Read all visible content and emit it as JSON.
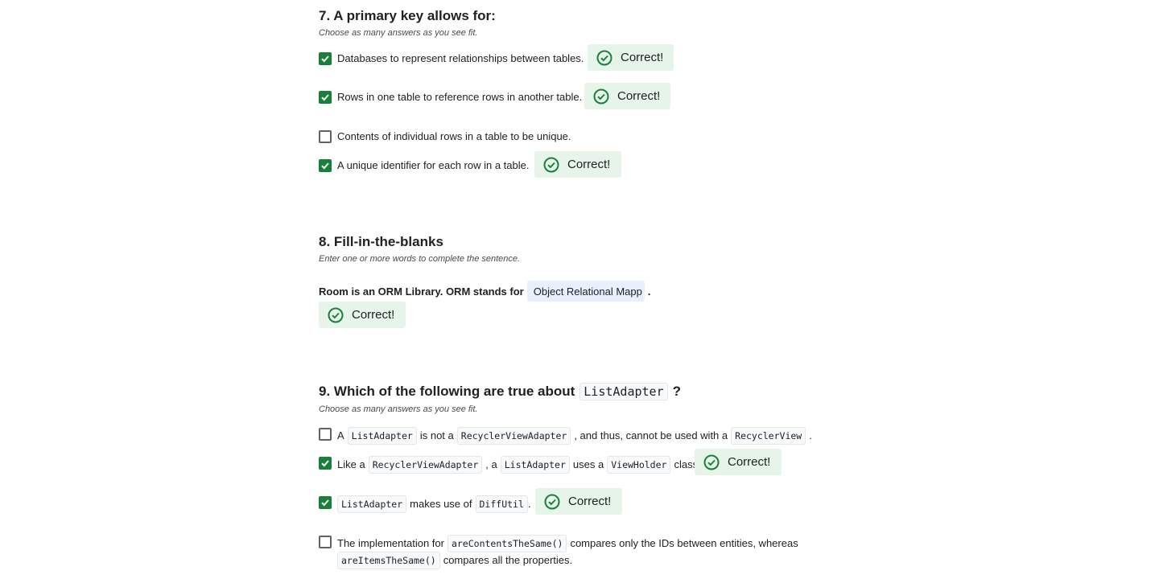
{
  "q7": {
    "title": "7. A primary key allows for:",
    "subtitle": "Choose as many answers as you see fit.",
    "options": [
      {
        "text": "Databases to represent relationships between tables.",
        "checked": true,
        "feedback": "Correct!"
      },
      {
        "text": "Rows in one table to reference rows in another table.",
        "checked": true,
        "feedback": "Correct!"
      },
      {
        "text": "Contents of individual rows in a table to be unique.",
        "checked": false
      },
      {
        "text": "A unique identifier for each row in a table.",
        "checked": true,
        "feedback": "Correct!"
      }
    ]
  },
  "q8": {
    "title": "8. Fill-in-the-blanks",
    "subtitle": "Enter one or more words to complete the sentence.",
    "sentence_prefix": "Room is an ORM Library. ORM stands for",
    "answer_value": "Object Relational Mapp",
    "sentence_suffix": ".",
    "feedback": "Correct!"
  },
  "q9": {
    "title_prefix": "9. Which of the following are true about",
    "title_code": "ListAdapter",
    "title_suffix": "?",
    "subtitle": "Choose as many answers as you see fit.",
    "opt1": {
      "t1": "A",
      "c1": "ListAdapter",
      "t2": "is not a",
      "c2": "RecyclerViewAdapter",
      "t3": ", and thus, cannot be used with a",
      "c3": "RecyclerView",
      "t4": ".",
      "checked": false
    },
    "opt2": {
      "t1": "Like a",
      "c1": "RecyclerViewAdapter",
      "t2": ", a",
      "c2": "ListAdapter",
      "t3": "uses a",
      "c3": "ViewHolder",
      "t4": "class.",
      "checked": true,
      "feedback": "Correct!"
    },
    "opt3": {
      "c1": "ListAdapter",
      "t1": "makes use of",
      "c2": "DiffUtil",
      "t2": ".",
      "checked": true,
      "feedback": "Correct!"
    },
    "opt4": {
      "t1": "The implementation for",
      "c1": "areContentsTheSame()",
      "t2": "compares only the IDs between entities, whereas",
      "c2": "areItemsTheSame()",
      "t3": "compares all the properties.",
      "checked": false
    }
  },
  "icons": {
    "check_circle": "check-circle-icon",
    "checkbox_checked": "checkbox-checked-icon"
  },
  "colors": {
    "accent_green": "#188038",
    "correct_bg": "#e6f4ea",
    "input_bg": "#e8f0fe"
  }
}
